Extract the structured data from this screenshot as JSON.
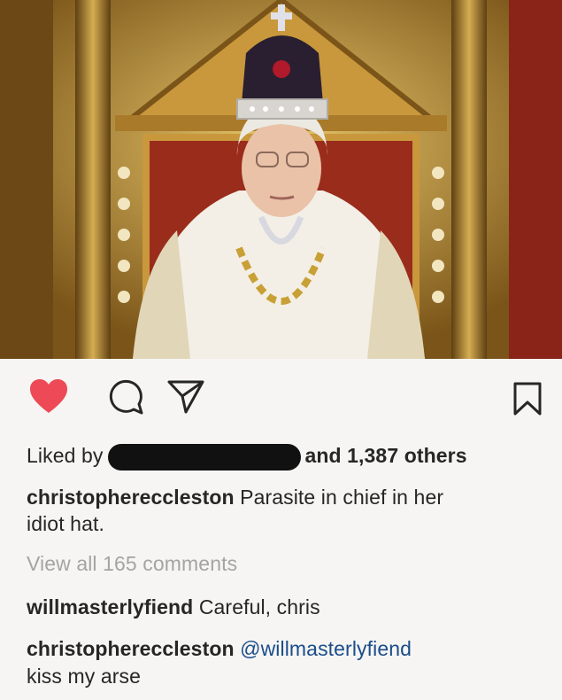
{
  "post": {
    "image": "queen-on-throne-photo"
  },
  "actions": {
    "like_icon": "heart-icon",
    "like_color": "#ed4956",
    "comment_icon": "comment-icon",
    "share_icon": "share-icon",
    "save_icon": "bookmark-icon"
  },
  "likes": {
    "prefix": "Liked by",
    "suffix": "and 1,387 others"
  },
  "caption": {
    "username": "christophereccleston",
    "text_line1": "Parasite in chief in her",
    "text_line2": "idiot hat."
  },
  "view_all_comments": "View all 165 comments",
  "comments": [
    {
      "username": "willmasterlyfiend",
      "text": "Careful, chris"
    },
    {
      "username": "christophereccleston",
      "mention": "@willmasterlyfiend",
      "text": "kiss my arse"
    }
  ],
  "colors": {
    "mention": "#1a4d8a",
    "muted": "#a4a4a4",
    "text": "#262626"
  }
}
